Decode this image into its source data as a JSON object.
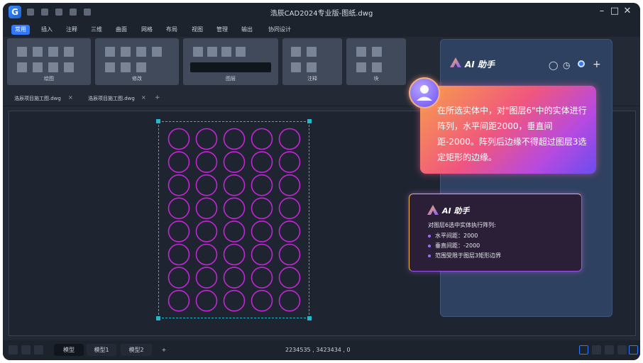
{
  "window": {
    "title": "浩辰CAD2024专业版-图纸.dwg",
    "app_logo_letter": "G"
  },
  "menu": {
    "items": [
      "常用",
      "插入",
      "注释",
      "三维",
      "曲面",
      "网格",
      "布局",
      "视图",
      "管理",
      "输出",
      "协同设计"
    ],
    "active_index": 0
  },
  "ribbon": {
    "groups": [
      "绘图",
      "修改",
      "图层",
      "注释",
      "块"
    ]
  },
  "doc_tabs": {
    "tabs": [
      "浩辰项目施工图.dwg",
      "浩辰项目施工图.dwg"
    ],
    "add_label": "+",
    "close_label": "×"
  },
  "drawing": {
    "circle_grid": {
      "columns": 5,
      "rows": 8
    },
    "circle_color": "#c026d3",
    "selection_color": "#22b8cf"
  },
  "status_bar": {
    "tabs": [
      "模型",
      "模型1",
      "模型2"
    ],
    "active_index": 0,
    "add_label": "+",
    "coordinates": "2234535 , 3423434 , 0"
  },
  "ai_panel": {
    "title": "AI 助手",
    "user_prompt": "在所选实体中，对\"图层6\"中的实体进行阵列，水平间距2000，垂直间距-2000。阵列后边缘不得超过图层3选定矩形的边缘。",
    "reply": {
      "title": "AI 助手",
      "intro": "对图层6选中实体执行阵列:",
      "items": [
        "水平间距：2000",
        "垂直间距：-2000",
        "范围受限于图层3矩形边界"
      ]
    }
  },
  "colors": {
    "accent": "#2f78ff",
    "background": "#232a36"
  }
}
